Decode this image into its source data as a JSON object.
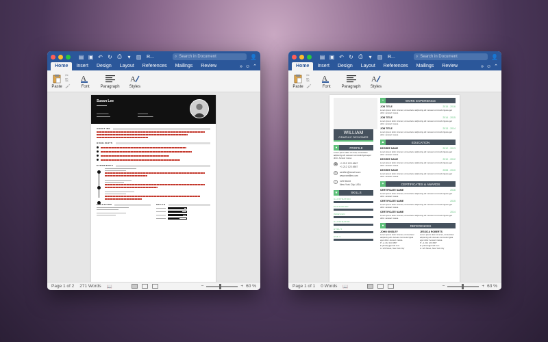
{
  "windows": {
    "left": {
      "title": "R...",
      "search_placeholder": "Search in Document",
      "menus": [
        "Home",
        "Insert",
        "Design",
        "Layout",
        "References",
        "Mailings",
        "Review"
      ],
      "ribbon": {
        "paste": "Paste",
        "font": "Font",
        "paragraph": "Paragraph",
        "styles": "Styles"
      },
      "status": {
        "page": "Page 1 of 2",
        "words": "271 Words",
        "zoom": "60 %"
      },
      "zoom_level": 0.6
    },
    "right": {
      "title": "R...",
      "search_placeholder": "Search in Document",
      "menus": [
        "Home",
        "Insert",
        "Design",
        "Layout",
        "References",
        "Mailings",
        "Review"
      ],
      "ribbon": {
        "paste": "Paste",
        "font": "Font",
        "paragraph": "Paragraph",
        "styles": "Styles"
      },
      "status": {
        "page": "Page 1 of 1",
        "words": "0 Words",
        "zoom": "63 %"
      },
      "zoom_level": 0.63
    }
  },
  "resume_left": {
    "name": "Susan Lee",
    "sections": {
      "about": "ABOUT ME",
      "highlights": "HIGHLIGHTS",
      "experience": "EXPERIENCE",
      "education": "EDUCATION",
      "skills": "SKILLS"
    }
  },
  "resume_right": {
    "name": "WILLIAM",
    "title": "GRAPHIC DESIGNER",
    "profile": "PROFILE",
    "skills_hdr": "SKILLS",
    "phone": "+1 212 123 4567",
    "phone2": "+1 212 123 4567",
    "email": "wmiller@email.com",
    "website": "www.wmiller.com",
    "address1": "123 Street",
    "address2": "New York City, USA",
    "skills": [
      "ILLUSTRATION",
      "PHOTOSHOP",
      "INDESIGN",
      "ILLUSTRATOR",
      "HTML 5",
      "CSS 3"
    ],
    "work_hdr": "WORK EXPERIENCE",
    "jobs": [
      {
        "title": "JOB TITLE",
        "date": "2015 - 2016"
      },
      {
        "title": "JOB TITLE",
        "date": "2014 - 2015"
      },
      {
        "title": "JOB TITLE",
        "date": "2013 - 2014"
      }
    ],
    "edu_hdr": "EDUCATION",
    "degrees": [
      {
        "title": "DEGREE NAME",
        "date": "2012 - 2013"
      },
      {
        "title": "DEGREE NAME",
        "date": "2010 - 2012"
      },
      {
        "title": "DEGREE NAME",
        "date": "2008 - 2010"
      }
    ],
    "cert_hdr": "CERTIFICATES & AWARDS",
    "certs": [
      {
        "title": "CERTIFICATE NAME",
        "date": "2016"
      },
      {
        "title": "CERTIFICATE NAME",
        "date": "2015"
      },
      {
        "title": "CERTIFICATE NAME",
        "date": "2014"
      }
    ],
    "ref_hdr": "REFERENCES",
    "refs": [
      {
        "name": "JOHN KINSLEY",
        "phone": "P: +1 212 123 4567",
        "email": "E: jkinsley@email.com",
        "addr": "A: 123 Street, New York City"
      },
      {
        "name": "JESSICA ROBERTS",
        "phone": "P: +1 212 123 4567",
        "email": "E: jroberts@email.com",
        "addr": "A: 123 Street, New York City"
      }
    ],
    "lorem": "Lorem ipsum dolor sit amet, consectetur adipiscing elit. Aenean commodo ligula eget dolor. Aenean massa."
  }
}
